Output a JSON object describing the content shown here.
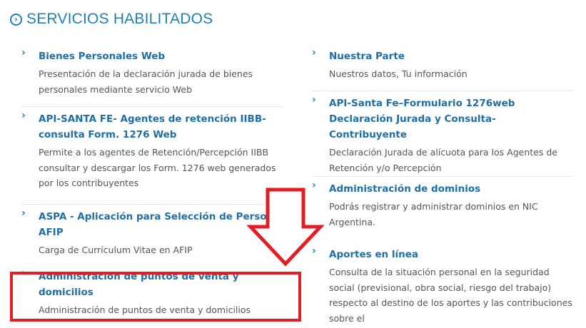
{
  "header": {
    "title": "SERVICIOS HABILITADOS"
  },
  "left_items": [
    {
      "title": "Bienes Personales Web",
      "desc": "Presentación de la declaración jurada de bienes personales mediante servicio Web"
    },
    {
      "title": "API-SANTA FE- Agentes de retención IIBB-consulta Form. 1276 Web",
      "desc": "Permite a los agentes de Retención/Percepción IIBB consultar y descargar los Form. 1276 web generados por los contribuyentes"
    },
    {
      "title": "ASPA - Aplicación para Selección de Personal AFIP",
      "desc": "Carga de Currículum Vitae en AFIP"
    },
    {
      "title": "Administración de puntos de venta y domicilios",
      "desc": "Administración de puntos de venta y domicilios"
    }
  ],
  "right_items": [
    {
      "title": "Nuestra Parte",
      "desc": "Nuestros datos, Tu información"
    },
    {
      "title": "API-Santa Fe–Formulario 1276web Declaración Jurada y Consulta-Contribuyente",
      "desc": "Declaración Jurada de alícuota para los Agentes de Retención y/o Percepción"
    },
    {
      "title": "Administración de dominios",
      "desc": "Podrás registrar y administrar dominios en NIC Argentina."
    },
    {
      "title": "Aportes en línea",
      "desc": "Consulta de la situación personal en la seguridad social (previsional, obra social, riesgo del trabajo) respecto al destino de los aportes y las contribuciones sobre el"
    }
  ],
  "colors": {
    "accent": "#1f7fb7",
    "highlight": "#e01e26"
  },
  "icons": {
    "header": "circle-chevron-right-icon",
    "item": "chevron-right-icon",
    "annotation": "arrow-down-icon"
  }
}
